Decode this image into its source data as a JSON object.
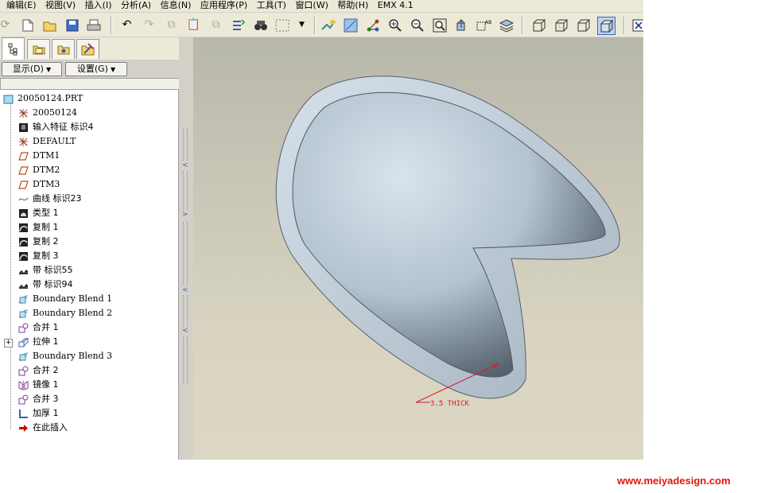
{
  "menu": {
    "items": [
      "编辑(E)",
      "视图(V)",
      "插入(I)",
      "分析(A)",
      "信息(N)",
      "应用程序(P)",
      "工具(T)",
      "窗口(W)",
      "帮助(H)",
      "EMX 4.1"
    ]
  },
  "panel": {
    "show_label": "显示(D)",
    "settings_label": "设置(G)"
  },
  "tree": {
    "items": [
      {
        "label": "20050124.PRT",
        "icon": "part-icon"
      },
      {
        "label": "20050124",
        "icon": "csys-icon"
      },
      {
        "label": "输入特征 标识4",
        "icon": "import-feature-icon"
      },
      {
        "label": "DEFAULT",
        "icon": "csys-icon"
      },
      {
        "label": "DTM1",
        "icon": "datum-plane-icon"
      },
      {
        "label": "DTM2",
        "icon": "datum-plane-icon"
      },
      {
        "label": "DTM3",
        "icon": "datum-plane-icon"
      },
      {
        "label": "曲线 标识23",
        "icon": "curve-icon"
      },
      {
        "label": "类型 1",
        "icon": "type-icon"
      },
      {
        "label": "复制 1",
        "icon": "copy-icon"
      },
      {
        "label": "复制 2",
        "icon": "copy-icon"
      },
      {
        "label": "复制 3",
        "icon": "copy-icon"
      },
      {
        "label": "带 标识55",
        "icon": "ribbon-icon"
      },
      {
        "label": "带 标识94",
        "icon": "ribbon-icon"
      },
      {
        "label": "Boundary Blend 1",
        "icon": "boundary-blend-icon"
      },
      {
        "label": "Boundary Blend 2",
        "icon": "boundary-blend-icon"
      },
      {
        "label": "合并 1",
        "icon": "merge-icon"
      },
      {
        "label": "拉伸 1",
        "icon": "extrude-icon",
        "expandable": true
      },
      {
        "label": "Boundary Blend 3",
        "icon": "boundary-blend-icon"
      },
      {
        "label": "合并 2",
        "icon": "merge-icon"
      },
      {
        "label": "镜像 1",
        "icon": "mirror-icon"
      },
      {
        "label": "合并 3",
        "icon": "merge-icon"
      },
      {
        "label": "加厚 1",
        "icon": "thicken-icon"
      },
      {
        "label": "在此插入",
        "icon": "insert-here-arrow-icon"
      }
    ]
  },
  "viewport": {
    "annotation": "3.5 THICK",
    "annotation_color": "#d61c2c",
    "model_color": "#b9c7d3"
  },
  "watermark": "www.meiyadesign.com",
  "colors": {
    "insert_arrow": "#d00000",
    "watermark": "#e3170a"
  }
}
